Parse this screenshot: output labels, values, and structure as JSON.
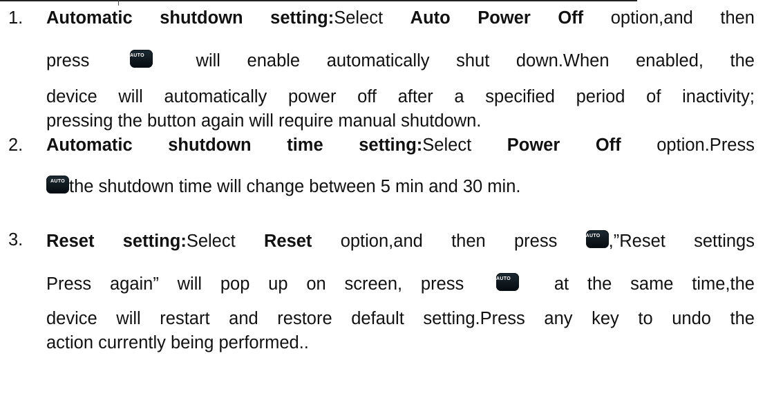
{
  "key_label": "AUTO",
  "item1": {
    "number": "1.",
    "title": "Automatic shutdown setting:",
    "t1": "Select ",
    "option": "Auto Power Off",
    "t2": " option,and then",
    "press": "press",
    "rest": "will enable automatically shut down.When enabled, the",
    "line3": "device will automatically power off after a specified period of inactivity;",
    "line4": "pressing the button again will require manual shutdown."
  },
  "item2": {
    "number": "2.",
    "title": "Automatic shutdown time setting:",
    "t1": "Select ",
    "option": "Power Off",
    "t2": " option.Press",
    "line2": "the shutdown time will change between 5 min and 30 min."
  },
  "item3": {
    "number": "3.",
    "title": "Reset setting:",
    "t1": "Select ",
    "option": "Reset",
    "t2": " option,and then press",
    "t3": ",”Reset settings",
    "l2a": "Press again” will pop up on screen, press",
    "l2b": "at the same time,the",
    "line3": "device will restart and restore default setting.Press any key to undo the",
    "line4": "action currently being performed.."
  }
}
